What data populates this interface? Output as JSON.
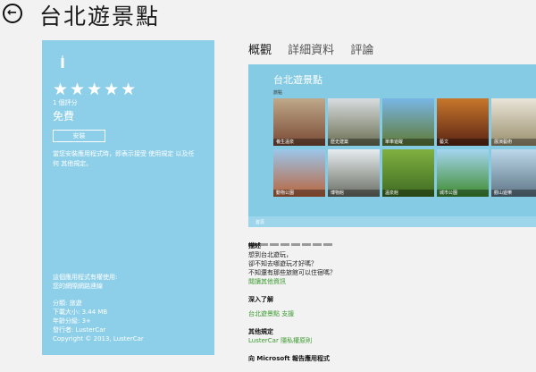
{
  "page_title": "台北遊景點",
  "app_panel": {
    "stars": "★★★★★",
    "rating_count": "1 個評分",
    "price": "免費",
    "install_label": "安裝",
    "terms_line1": "當您安裝應用程式時，即表示接受 使用規定 以及任",
    "terms_line2": "何 其他規定。",
    "net_line1": "這個應用程式有權使用:",
    "net_line2": "您的網際網路連線",
    "category": "分類: 旅遊",
    "size": "下載大小: 3.44 MB",
    "age": "年齡分級: 3+",
    "publisher": "發行者: LusterCar",
    "copyright": "Copyright © 2013, LusterCar"
  },
  "tabs": [
    "概觀",
    "詳細資料",
    "評論"
  ],
  "screenshot": {
    "title": "台北遊景點",
    "subtitle": "旅點",
    "tiles": [
      "養生溫泉",
      "歷史建築",
      "單車遊蹤",
      "藝文",
      "展演藝術",
      "動物公園",
      "博物館",
      "溫泉館",
      "城市公園",
      "觀山遊樂"
    ],
    "footer": "首頁"
  },
  "details": {
    "desc_h": "描述",
    "desc_1": "想到台北遊玩，",
    "desc_2": "卻不知去哪遊玩才好嗎？",
    "desc_3": "不知還有那些旅館可以住宿嗎？",
    "more_info": "閱讀其他資訊",
    "learn_h": "深入了解",
    "support": "台北遊景點 支援",
    "other_h": "其他規定",
    "privacy": "LusterCar 隱私權原則",
    "report_h": "向 Microsoft 報告應用程式"
  }
}
